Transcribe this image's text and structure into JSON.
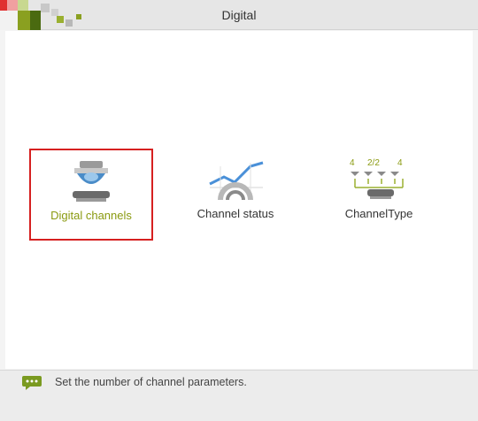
{
  "window": {
    "title": "Digital"
  },
  "colors": {
    "accent": "#d62020",
    "selected_label": "#8a9a10",
    "titlebar": "#e6e6e6"
  },
  "tiles": [
    {
      "label": "Digital channels",
      "icon": "camera-dome-icon",
      "selected": true
    },
    {
      "label": "Channel status",
      "icon": "chart-gauge-icon",
      "selected": false
    },
    {
      "label": "ChannelType",
      "icon": "channel-type-icon",
      "selected": false
    }
  ],
  "channel_type_counts": {
    "left": "4",
    "middle": "2/2",
    "right": "4"
  },
  "status": {
    "icon": "message-icon",
    "text": "Set the number of channel parameters."
  }
}
